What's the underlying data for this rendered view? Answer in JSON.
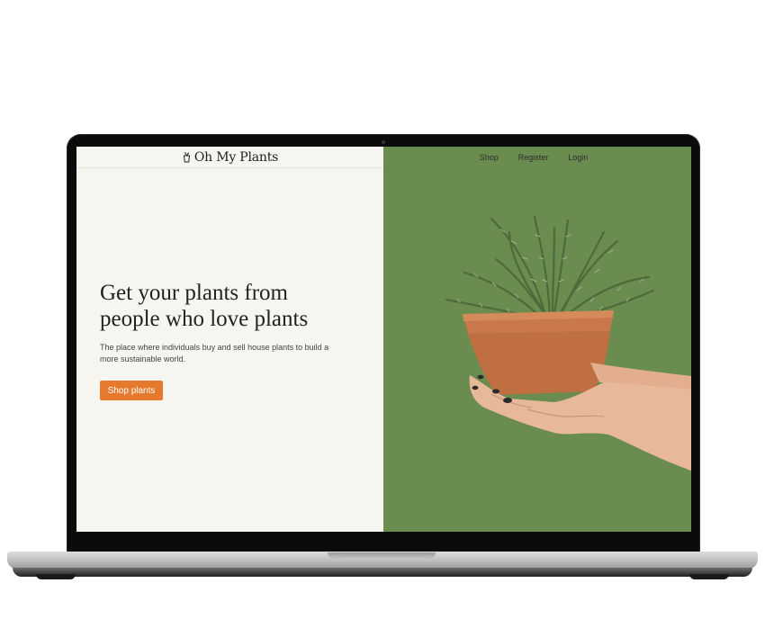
{
  "brand": {
    "name": "Oh My Plants",
    "logo_icon": "plant-pot-icon"
  },
  "nav": {
    "links": [
      "Shop",
      "Register",
      "Login"
    ]
  },
  "hero": {
    "headline_line1": "Get your plants from",
    "headline_line2": "people who love plants",
    "subtext": "The place where individuals buy and sell house plants to build a more sustainable world.",
    "cta_label": "Shop plants"
  },
  "colors": {
    "left_background": "#f7f5f0",
    "right_background": "#6a8c4e",
    "cta_background": "#e57a2e",
    "pot": "#c8784a"
  },
  "image": {
    "description_icon": "potted-plant-in-hands-icon"
  }
}
